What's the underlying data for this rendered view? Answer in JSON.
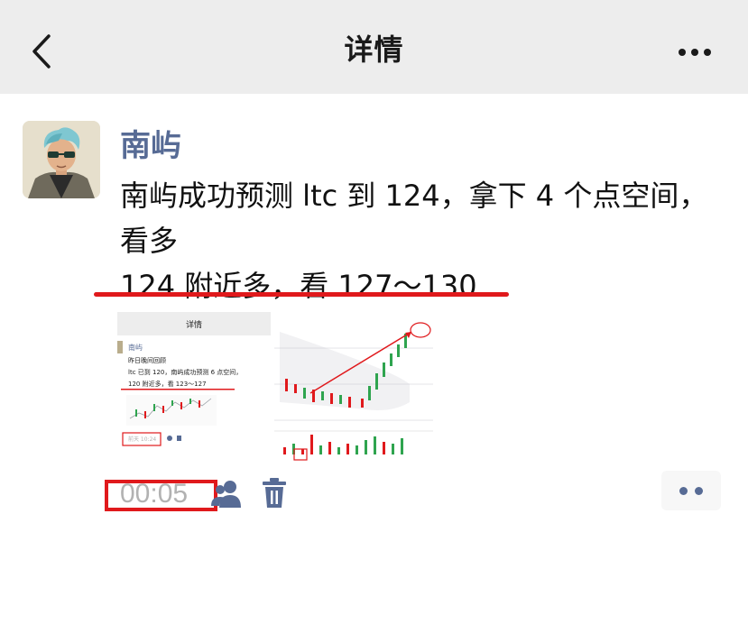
{
  "navbar": {
    "title": "详情",
    "back_icon": "chevron-left-icon",
    "more_icon": "more-horizontal-icon"
  },
  "post": {
    "username": "南屿",
    "text_lines": [
      "南屿成功预测 ltc 到 124，拿下 4 个点空间，",
      "看多",
      "124 附近多，看 127～130"
    ],
    "time": "00:05",
    "friends_icon": "friends-icon",
    "delete_icon": "trash-icon",
    "more_action_icon": "comment-more-icon"
  },
  "image1": {
    "header": "详情",
    "username": "南屿",
    "lines": [
      "昨日晚间回顾",
      "ltc 已到 120，南屿成功预测 6 点空间，",
      "120 附近多，看 123～127"
    ],
    "time": "前天 10:24"
  },
  "colors": {
    "accent": "#576b95",
    "annotation_red": "#e0191c",
    "navbar_bg": "#ededed",
    "time_gray": "#b2b2b2"
  }
}
